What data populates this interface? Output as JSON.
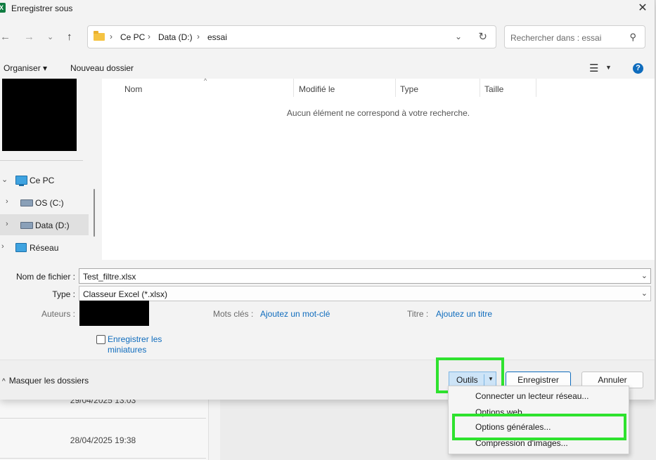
{
  "window": {
    "title": "Enregistrer sous",
    "app_icon_letter": "X"
  },
  "background": {
    "rows": [
      "29/04/2025 13:03",
      "28/04/2025 19:38"
    ]
  },
  "address_bar": {
    "crumbs": [
      "Ce PC",
      "Data (D:)",
      "essai"
    ]
  },
  "search": {
    "placeholder": "Rechercher dans : essai"
  },
  "toolbar": {
    "organize": "Organiser ▾",
    "new_folder": "Nouveau dossier"
  },
  "nav_tree": [
    {
      "label": "Ce PC",
      "expanded": true,
      "icon": "computer-icon"
    },
    {
      "label": "OS (C:)",
      "icon": "os-drive-icon"
    },
    {
      "label": "Data (D:)",
      "icon": "drive-icon",
      "selected": true
    },
    {
      "label": "Réseau",
      "icon": "network-icon"
    }
  ],
  "file_list": {
    "columns": [
      "Nom",
      "Modifié le",
      "Type",
      "Taille"
    ],
    "empty_message": "Aucun élément ne correspond à votre recherche."
  },
  "form": {
    "filename_label": "Nom de fichier :",
    "filename_value": "Test_filtre.xlsx",
    "type_label": "Type :",
    "type_value": "Classeur Excel (*.xlsx)",
    "authors_label": "Auteurs :",
    "keywords_label": "Mots clés :",
    "keywords_link": "Ajoutez un mot-clé",
    "title_label": "Titre :",
    "title_link": "Ajoutez un titre",
    "thumbnails_line1": "Enregistrer les",
    "thumbnails_line2": "miniatures",
    "thumbnails_checked": false
  },
  "footer": {
    "hide_folders": "Masquer les dossiers",
    "tools": "Outils",
    "save": "Enregistrer",
    "cancel": "Annuler"
  },
  "tools_menu": {
    "items": [
      "Connecter un lecteur réseau...",
      "Options web...",
      "Options générales...",
      "Compression d'images..."
    ]
  },
  "colors": {
    "highlight": "#2ee22e",
    "accent": "#0f6cbd",
    "selected_button": "#cde4f7"
  }
}
